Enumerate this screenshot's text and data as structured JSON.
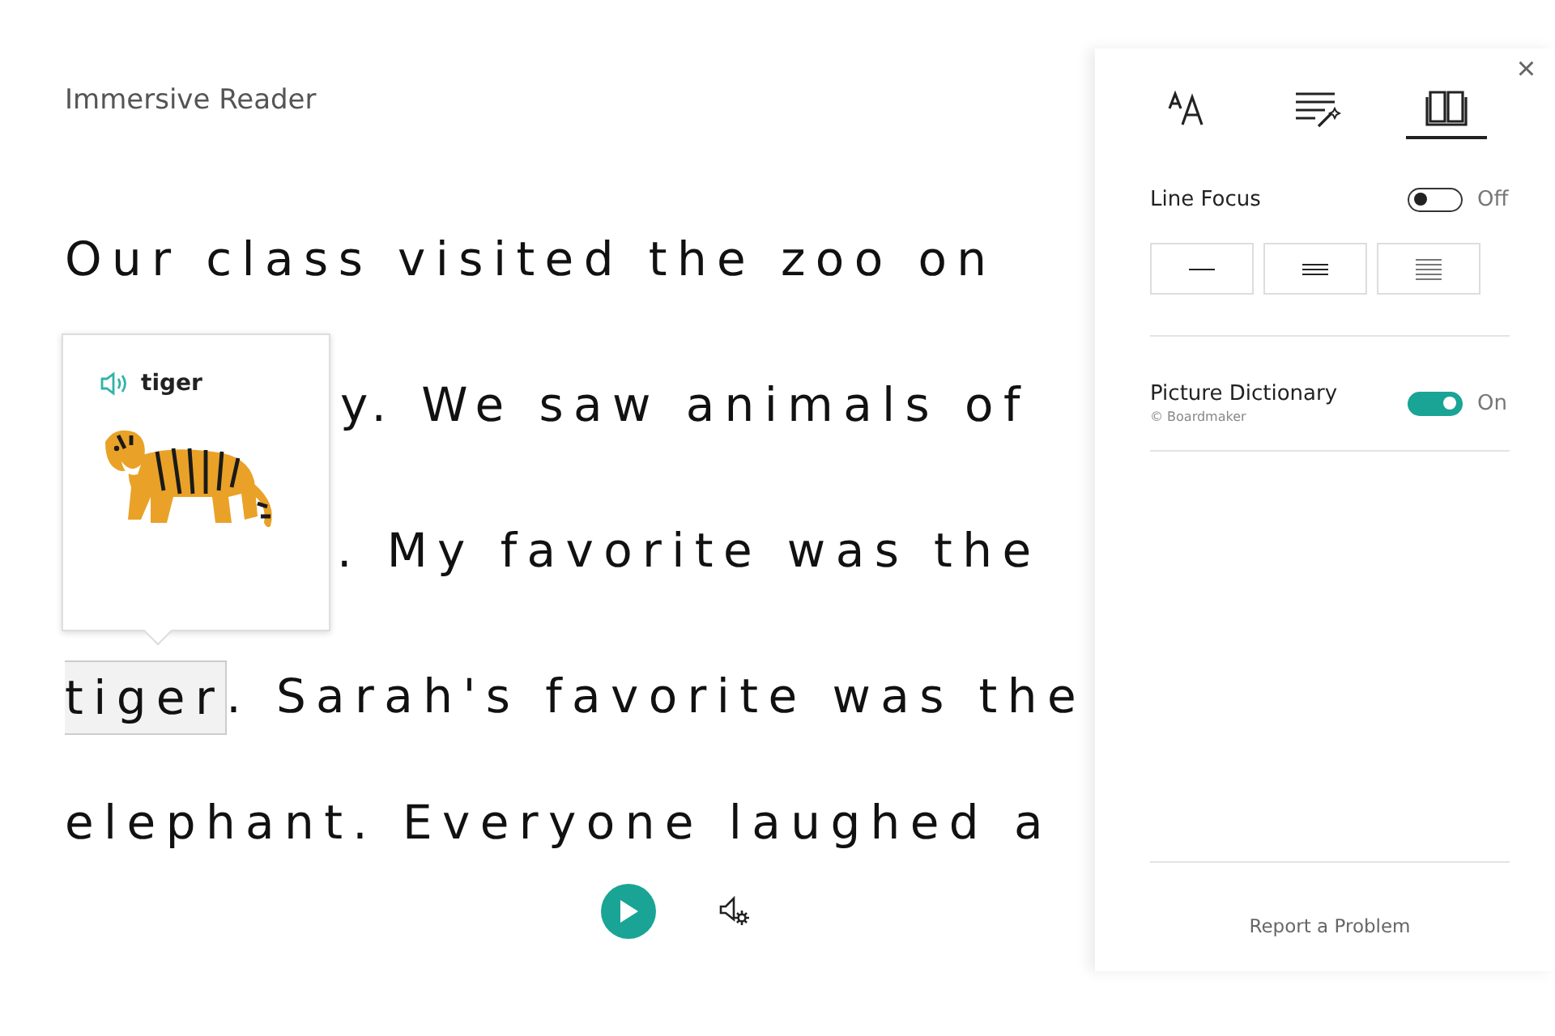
{
  "app_title": "Immersive Reader",
  "lines": [
    {
      "text": "Our class visited the zoo on"
    },
    {
      "text": "y. We saw animals of"
    },
    {
      "text": ". My favorite was the"
    },
    {
      "highlight": "tiger",
      "text": ". Sarah's favorite was the"
    },
    {
      "text": "elephant. Everyone laughed a"
    }
  ],
  "popup": {
    "word": "tiger"
  },
  "panel": {
    "close": "×",
    "tabs": [
      {
        "kind": "text-size",
        "selected": false
      },
      {
        "kind": "grammar",
        "selected": false
      },
      {
        "kind": "book",
        "selected": true
      }
    ],
    "line_focus": {
      "label": "Line Focus",
      "on": false,
      "state_text": "Off",
      "options": [
        {
          "kind": "single"
        },
        {
          "kind": "triple"
        },
        {
          "kind": "five"
        }
      ]
    },
    "picture_dictionary": {
      "label": "Picture Dictionary",
      "on": true,
      "state_text": "On",
      "credit": "© Boardmaker"
    },
    "report": "Report a Problem"
  }
}
